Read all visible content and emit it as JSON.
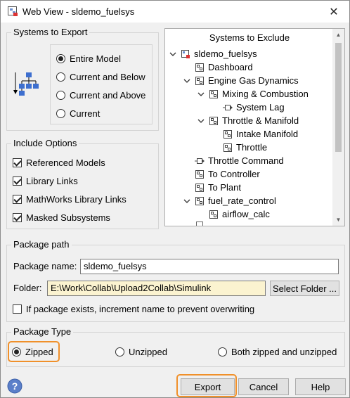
{
  "window": {
    "title": "Web View - sldemo_fuelsys",
    "close_glyph": "✕"
  },
  "export_group": {
    "legend": "Systems to Export",
    "options": [
      {
        "label": "Entire Model",
        "selected": true
      },
      {
        "label": "Current and Below",
        "selected": false
      },
      {
        "label": "Current and Above",
        "selected": false
      },
      {
        "label": "Current",
        "selected": false
      }
    ],
    "icon": "model-hierarchy-icon"
  },
  "include_group": {
    "legend": "Include Options",
    "options": [
      {
        "label": "Referenced Models",
        "checked": true
      },
      {
        "label": "Library Links",
        "checked": true
      },
      {
        "label": "MathWorks Library Links",
        "checked": true
      },
      {
        "label": "Masked Subsystems",
        "checked": true
      }
    ]
  },
  "exclude_tree": {
    "header": "Systems to Exclude",
    "rows": [
      {
        "label": "sldemo_fuelsys",
        "expanded": true,
        "icon": "model-icon"
      },
      {
        "label": "Dashboard",
        "expanded": null,
        "icon": "subsystem-icon"
      },
      {
        "label": "Engine Gas Dynamics",
        "expanded": true,
        "icon": "subsystem-icon"
      },
      {
        "label": "Mixing & Combustion",
        "expanded": true,
        "icon": "subsystem-icon"
      },
      {
        "label": "System Lag",
        "expanded": null,
        "icon": "block-icon"
      },
      {
        "label": "Throttle & Manifold",
        "expanded": true,
        "icon": "subsystem-icon"
      },
      {
        "label": "Intake Manifold",
        "expanded": null,
        "icon": "subsystem-icon"
      },
      {
        "label": "Throttle",
        "expanded": null,
        "icon": "subsystem-icon"
      },
      {
        "label": "Throttle Command",
        "expanded": null,
        "icon": "block-icon"
      },
      {
        "label": "To Controller",
        "expanded": null,
        "icon": "subsystem-icon"
      },
      {
        "label": "To Plant",
        "expanded": null,
        "icon": "subsystem-icon"
      },
      {
        "label": "fuel_rate_control",
        "expanded": true,
        "icon": "subsystem-icon"
      },
      {
        "label": "airflow_calc",
        "expanded": null,
        "icon": "subsystem-icon"
      }
    ]
  },
  "package_path": {
    "legend": "Package path",
    "name_label": "Package name:",
    "name_value": "sldemo_fuelsys",
    "folder_label": "Folder:",
    "folder_value": "E:\\Work\\Collab\\Upload2Collab\\Simulink",
    "select_folder_label": "Select Folder ...",
    "increment_label": "If package exists, increment name to prevent overwriting",
    "increment_checked": false
  },
  "package_type": {
    "legend": "Package Type",
    "options": [
      {
        "label": "Zipped",
        "selected": true
      },
      {
        "label": "Unzipped",
        "selected": false
      },
      {
        "label": "Both zipped and unzipped",
        "selected": false
      }
    ]
  },
  "footer": {
    "help_icon": "help-icon",
    "export_label": "Export",
    "cancel_label": "Cancel",
    "help_label": "Help"
  },
  "colors": {
    "highlight": "#f0902a",
    "folder_bg": "#fbf3d0"
  }
}
